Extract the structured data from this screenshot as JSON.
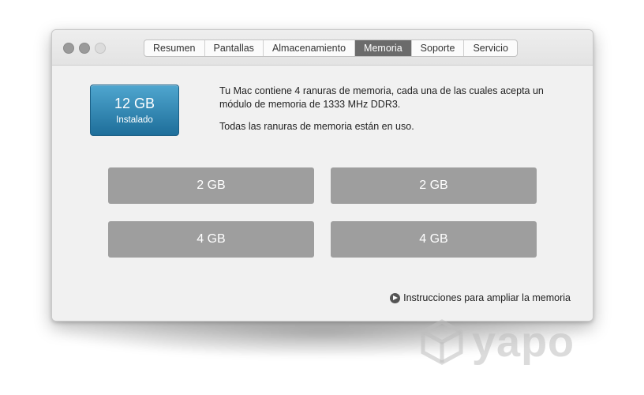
{
  "tabs": [
    {
      "label": "Resumen",
      "active": false
    },
    {
      "label": "Pantallas",
      "active": false
    },
    {
      "label": "Almacenamiento",
      "active": false
    },
    {
      "label": "Memoria",
      "active": true
    },
    {
      "label": "Soporte",
      "active": false
    },
    {
      "label": "Servicio",
      "active": false
    }
  ],
  "memory": {
    "size": "12 GB",
    "status": "Instalado",
    "info_line1": "Tu Mac contiene 4 ranuras de memoria, cada una de las cuales acepta un módulo de memoria de 1333 MHz DDR3.",
    "info_line2": "Todas las ranuras de memoria están en uso."
  },
  "slots": [
    "2 GB",
    "2 GB",
    "4 GB",
    "4 GB"
  ],
  "help_link": "Instrucciones para ampliar la memoria",
  "watermark": "yapo",
  "colors": {
    "badge_blue": "#2f86b5",
    "slot_gray": "#9e9e9e",
    "active_tab": "#6b6b6b"
  }
}
